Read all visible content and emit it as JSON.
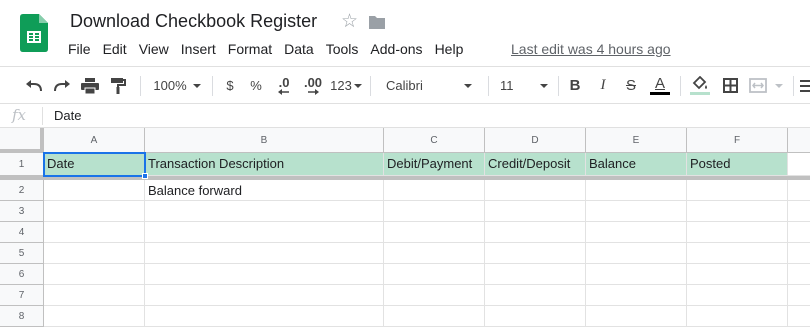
{
  "document": {
    "title": "Download Checkbook Register",
    "last_edit": "Last edit was 4 hours ago"
  },
  "icons": {
    "logo": "google-sheets-logo",
    "star": "star-icon",
    "folder": "folder-icon"
  },
  "menu": [
    "File",
    "Edit",
    "View",
    "Insert",
    "Format",
    "Data",
    "Tools",
    "Add-ons",
    "Help"
  ],
  "toolbar": {
    "zoom": "100%",
    "currency": "$",
    "percent": "%",
    "decrease_decimal": ".0",
    "increase_decimal": ".00",
    "number_format": "123",
    "font": "Calibri",
    "font_size": "11",
    "bold": "B",
    "italic": "I",
    "strike": "S",
    "text_color": "A"
  },
  "formula_bar": {
    "fx": "fx",
    "value": "Date"
  },
  "grid": {
    "columns": [
      "A",
      "B",
      "C",
      "D",
      "E",
      "F"
    ],
    "rows": [
      "1",
      "2",
      "3",
      "4",
      "5",
      "6",
      "7",
      "8"
    ],
    "header_fill": "#b7e1cd",
    "selection_color": "#1a73e8",
    "cells": {
      "A1": "Date",
      "B1": "Transaction Description",
      "C1": "Debit/Payment",
      "D1": "Credit/Deposit",
      "E1": "Balance",
      "F1": "Posted",
      "B2": "Balance forward"
    },
    "selected_cell": "A1"
  }
}
